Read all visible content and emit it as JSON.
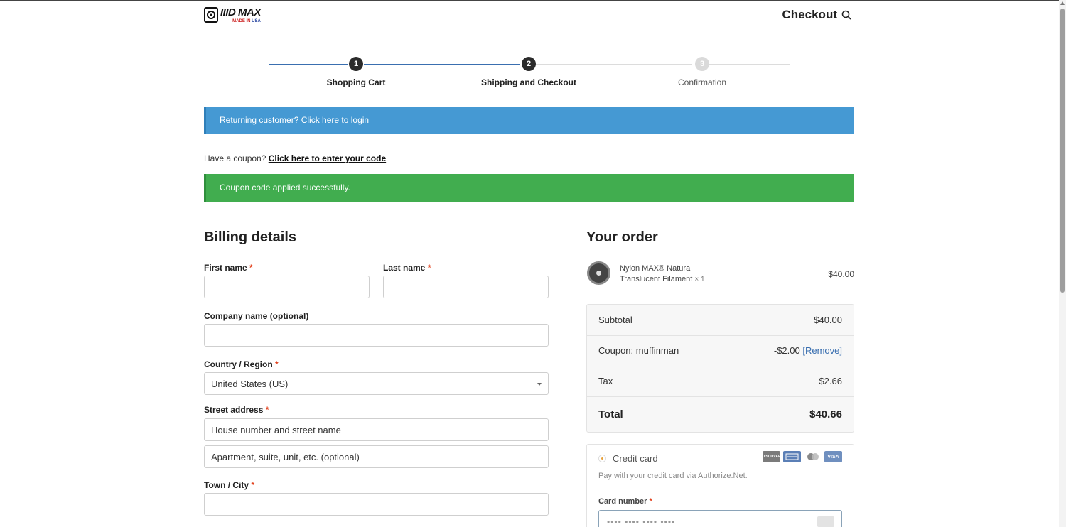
{
  "header": {
    "logo_text": "IIID MAX",
    "logo_sub_made": "MADE IN",
    "logo_sub_usa": "USA",
    "title": "Checkout"
  },
  "progress": {
    "steps": [
      {
        "number": "1",
        "label": "Shopping Cart",
        "state": "done"
      },
      {
        "number": "2",
        "label": "Shipping and Checkout",
        "state": "current"
      },
      {
        "number": "3",
        "label": "Confirmation",
        "state": "todo"
      }
    ]
  },
  "notices": {
    "returning_customer": "Returning customer? Click here to login",
    "coupon_prompt": "Have a coupon?",
    "coupon_link": "Click here to enter your code",
    "coupon_success": "Coupon code applied successfully."
  },
  "billing": {
    "heading": "Billing details",
    "first_name_label": "First name",
    "last_name_label": "Last name",
    "company_label": "Company name (optional)",
    "country_label": "Country / Region",
    "country_value": "United States (US)",
    "street_label": "Street address",
    "street_placeholder_1": "House number and street name",
    "street_placeholder_2": "Apartment, suite, unit, etc. (optional)",
    "city_label": "Town / City",
    "required_mark": "*"
  },
  "order": {
    "heading": "Your order",
    "item_name": "Nylon MAX® Natural Translucent Filament",
    "item_qty": "× 1",
    "item_price": "$40.00",
    "subtotal_label": "Subtotal",
    "subtotal_value": "$40.00",
    "coupon_label": "Coupon: muffinman",
    "coupon_value": "-$2.00",
    "coupon_remove": "[Remove]",
    "tax_label": "Tax",
    "tax_value": "$2.66",
    "total_label": "Total",
    "total_value": "$40.66"
  },
  "payment": {
    "method_label": "Credit card",
    "description": "Pay with your credit card via Authorize.Net.",
    "card_number_label": "Card number",
    "card_number_placeholder": "•••• •••• •••• ••••",
    "card_brands": [
      "discover",
      "amex",
      "mastercard",
      "visa"
    ],
    "visa_text": "VISA",
    "discover_text": "DISCOVER"
  },
  "colors": {
    "info_blue": "#4599d3",
    "success_green": "#41ad4f",
    "progress_blue": "#3a6fb0",
    "required_red": "#e2401c"
  }
}
